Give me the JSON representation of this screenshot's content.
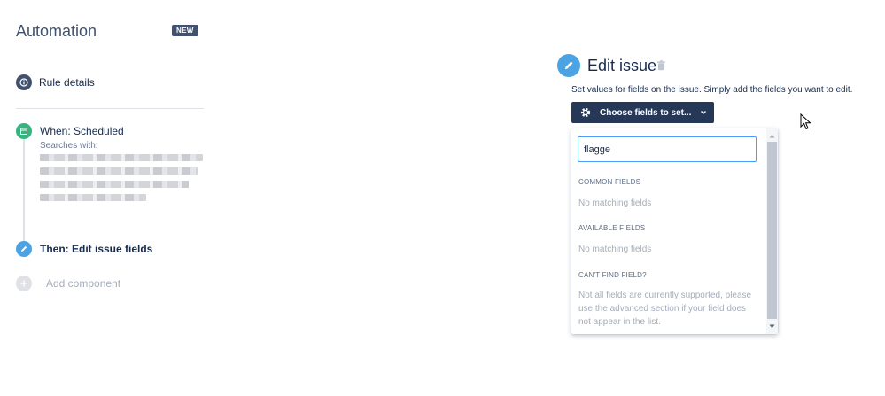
{
  "sidebar": {
    "title": "Automation",
    "badge": "NEW",
    "rule_details": "Rule details",
    "trigger": {
      "label": "When: Scheduled",
      "sub_label": "Searches with:"
    },
    "action": {
      "label": "Then: Edit issue fields"
    },
    "add_component": "Add component"
  },
  "editor": {
    "title": "Edit issue",
    "description": "Set values for fields on the issue. Simply add the fields you want to edit.",
    "choose_button": "Choose fields to set...",
    "dropdown": {
      "search_value": "flagge",
      "common_header": "COMMON FIELDS",
      "common_empty": "No matching fields",
      "available_header": "AVAILABLE FIELDS",
      "available_empty": "No matching fields",
      "cant_find_header": "CAN'T FIND FIELD?",
      "cant_find_help": "Not all fields are currently supported, please use the advanced section if your field does not appear in the list."
    }
  },
  "colors": {
    "accent_blue": "#4ba3e3",
    "navy": "#253858",
    "green": "#36b37e",
    "badge": "#42526e"
  }
}
